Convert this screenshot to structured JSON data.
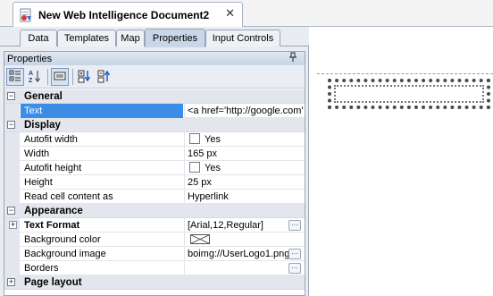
{
  "document": {
    "title": "New Web Intelligence Document2",
    "close_glyph": "✕"
  },
  "panel_tabs": [
    {
      "label": "Data",
      "active": false
    },
    {
      "label": "Templates",
      "active": false
    },
    {
      "label": "Map",
      "active": false
    },
    {
      "label": "Properties",
      "active": true
    },
    {
      "label": "Input Controls",
      "active": false
    }
  ],
  "properties_panel": {
    "title": "Properties",
    "pin_glyph": "📌",
    "toolbar_icons": [
      "categorized-icon",
      "alphabetical-icon",
      "property-pages-icon",
      "expand-all-icon",
      "collapse-all-icon"
    ]
  },
  "grid": {
    "general": {
      "label": "General"
    },
    "text": {
      "name": "Text",
      "value": "<a href='http://google.com' s"
    },
    "display": {
      "label": "Display"
    },
    "autofit_width": {
      "name": "Autofit width",
      "value": "Yes"
    },
    "width": {
      "name": "Width",
      "value": "165 px"
    },
    "autofit_height": {
      "name": "Autofit height",
      "value": "Yes"
    },
    "height": {
      "name": "Height",
      "value": "25 px"
    },
    "read_cell": {
      "name": "Read cell content as",
      "value": "Hyperlink"
    },
    "appearance": {
      "label": "Appearance"
    },
    "text_format": {
      "name": "Text Format",
      "value": "[Arial,12,Regular]"
    },
    "background_color": {
      "name": "Background color",
      "value": ""
    },
    "background_image": {
      "name": "Background image",
      "value": "boimg://UserLogo1.png"
    },
    "borders": {
      "name": "Borders",
      "value": ""
    },
    "page_layout": {
      "label": "Page layout"
    }
  },
  "colors": {
    "selection": "#3b8de6",
    "active_tab": "#c9d6e8",
    "panel_bg": "#e9ecf1"
  }
}
